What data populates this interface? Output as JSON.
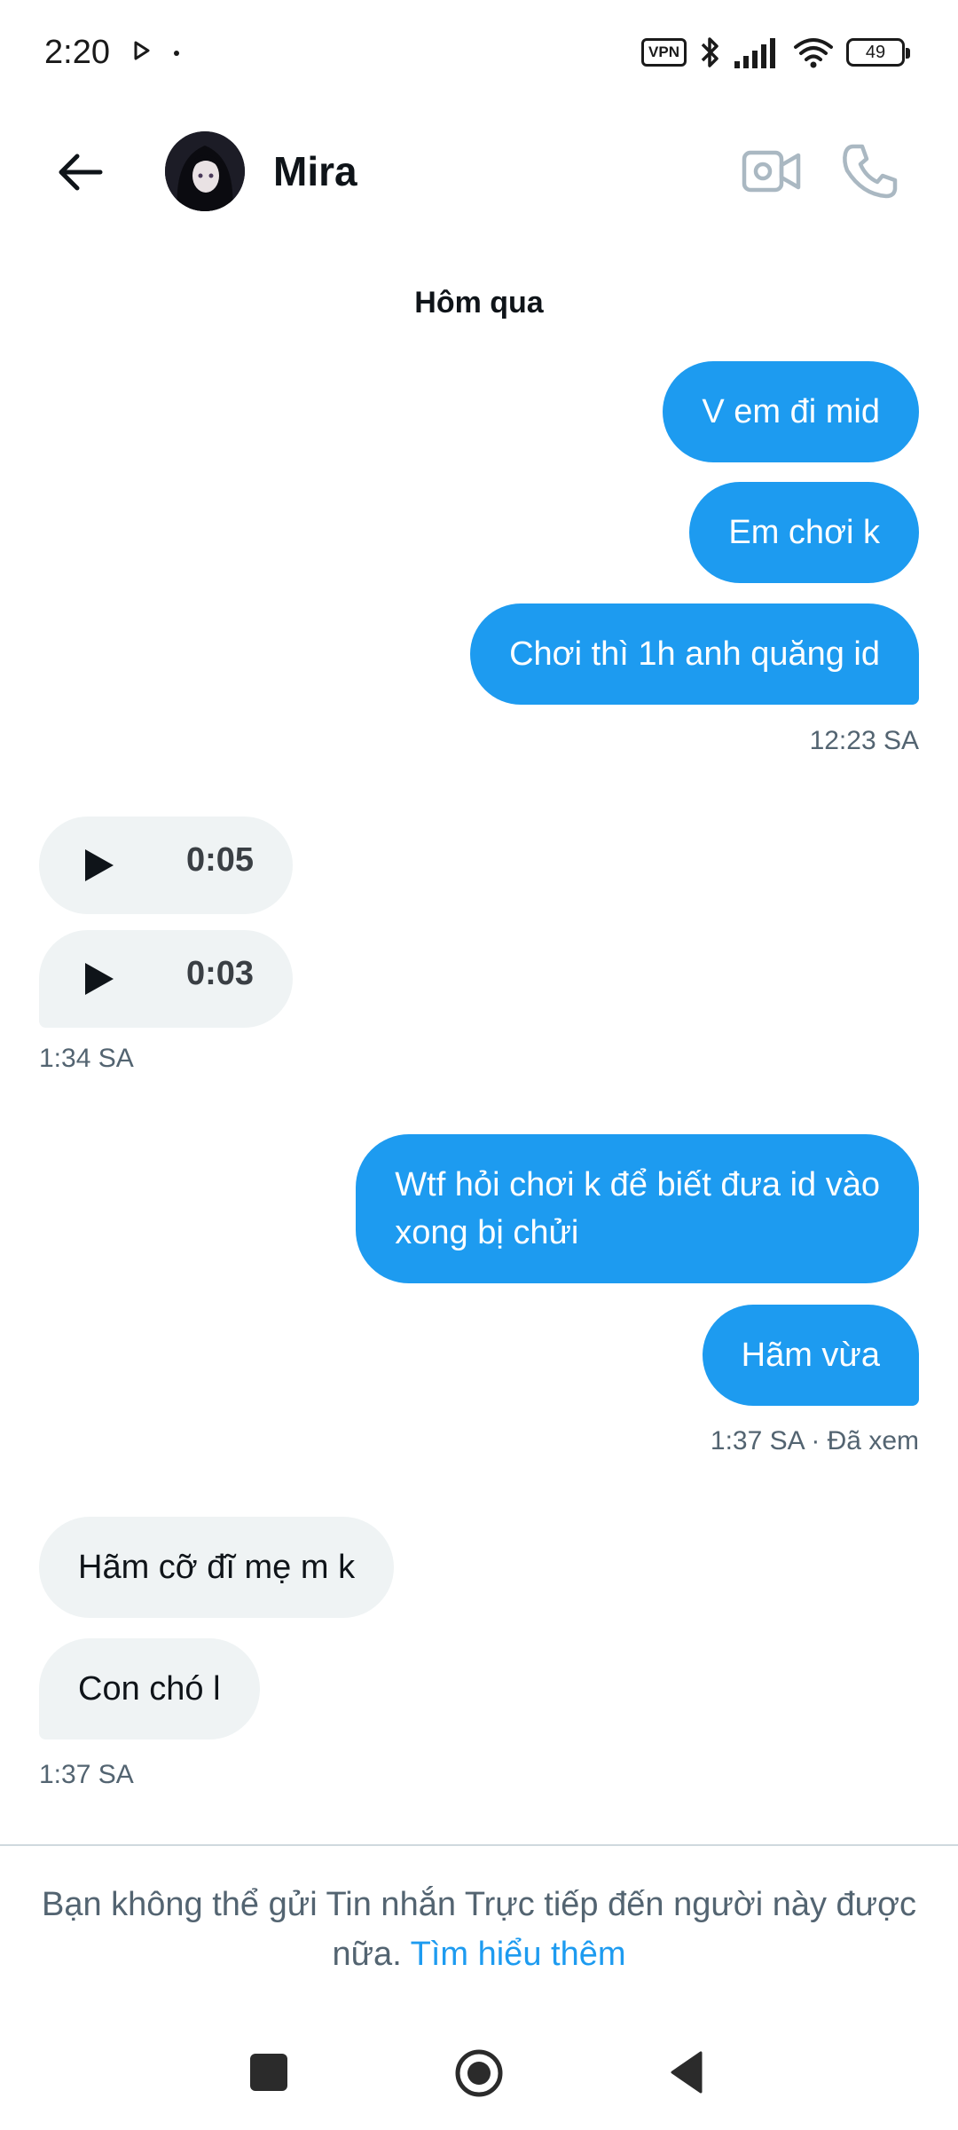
{
  "status_bar": {
    "time": "2:20",
    "vpn": "VPN",
    "battery": "49"
  },
  "header": {
    "contact_name": "Mira"
  },
  "conversation": {
    "day_label": "Hôm qua",
    "group1": {
      "messages": [
        "V em đi mid",
        "Em chơi k",
        "Chơi thì 1h anh quăng id"
      ],
      "time": "12:23 SA"
    },
    "group2": {
      "audio": [
        "0:05",
        "0:03"
      ],
      "time": "1:34 SA"
    },
    "group3": {
      "messages": [
        "Wtf hỏi chơi k để biết đưa id vào\nxong bị chửi",
        "Hãm vừa"
      ],
      "time": "1:37 SA · Đã xem"
    },
    "group4": {
      "messages": [
        "Hãm cỡ đĩ mẹ m k",
        "Con chó l"
      ],
      "time": "1:37 SA"
    }
  },
  "notice": {
    "text": "Bạn không thể gửi Tin nhắn Trực tiếp đến người này được nữa.",
    "link": "Tìm hiểu thêm"
  },
  "colors": {
    "sent_bubble": "#1d9bf0",
    "received_bubble": "#eff3f4",
    "link": "#1d9bf0"
  }
}
